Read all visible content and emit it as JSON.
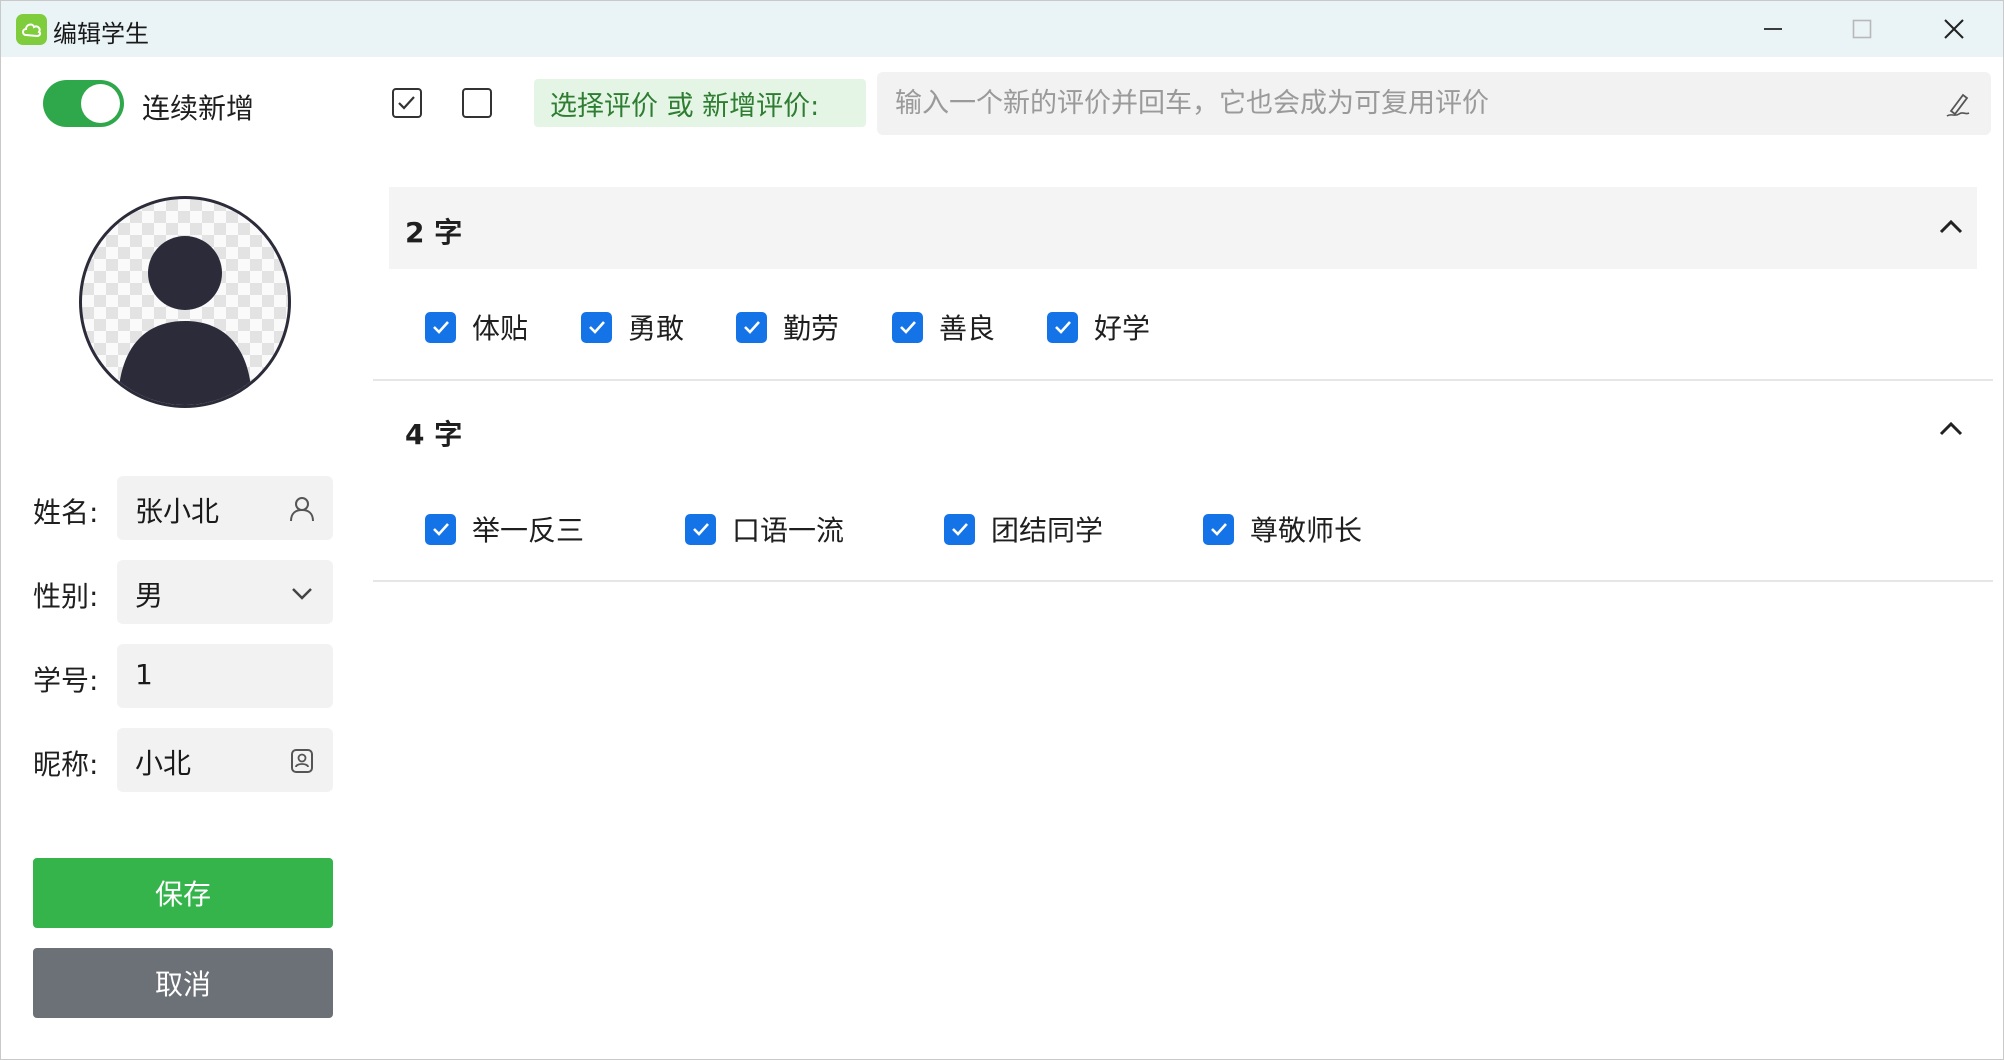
{
  "window": {
    "title": "编辑学生"
  },
  "left": {
    "continuous_add_label": "连续新增",
    "continuous_add_on": true,
    "fields": {
      "name": {
        "label": "姓名:",
        "value": "张小北"
      },
      "gender": {
        "label": "性别:",
        "value": "男"
      },
      "student_no": {
        "label": "学号:",
        "value": "1"
      },
      "nickname": {
        "label": "昵称:",
        "value": "小北"
      }
    },
    "save_label": "保存",
    "cancel_label": "取消"
  },
  "toolbar": {
    "eval_tag": "选择评价 或 新增评价:",
    "input_placeholder": "输入一个新的评价并回车，它也会成为可复用评价"
  },
  "groups": [
    {
      "title": "2 字",
      "items": [
        "体贴",
        "勇敢",
        "勤劳",
        "善良",
        "好学"
      ]
    },
    {
      "title": "4 字",
      "items": [
        "举一反三",
        "口语一流",
        "团结同学",
        "尊敬师长"
      ]
    }
  ],
  "colors": {
    "accent_green": "#35b44c",
    "checkbox_blue": "#1473e6",
    "cancel_gray": "#6c7077"
  }
}
